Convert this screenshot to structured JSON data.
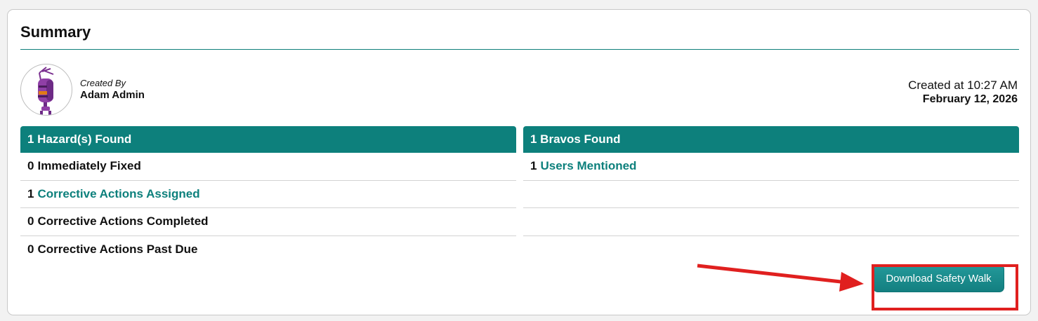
{
  "summary": {
    "title": "Summary",
    "created_by_label": "Created By",
    "created_by_name": "Adam Admin",
    "created_at": "Created at 10:27 AM",
    "created_date": "February 12, 2026"
  },
  "hazards": {
    "header": "1 Hazard(s) Found",
    "rows": [
      {
        "num": "0",
        "label": "Immediately Fixed"
      },
      {
        "num": "1",
        "label": "Corrective Actions Assigned"
      },
      {
        "num": "0",
        "label": "Corrective Actions Completed"
      },
      {
        "num": "0",
        "label": "Corrective Actions Past Due"
      }
    ]
  },
  "bravos": {
    "header": "1 Bravos Found",
    "rows": [
      {
        "num": "1",
        "label": "Users Mentioned"
      }
    ]
  },
  "actions": {
    "download_label": "Download Safety Walk"
  },
  "colors": {
    "accent": "#0d807c",
    "annotation": "#e0201f"
  },
  "icons": {
    "avatar": "robot-avatar-icon",
    "arrow": "red-arrow-annotation"
  }
}
